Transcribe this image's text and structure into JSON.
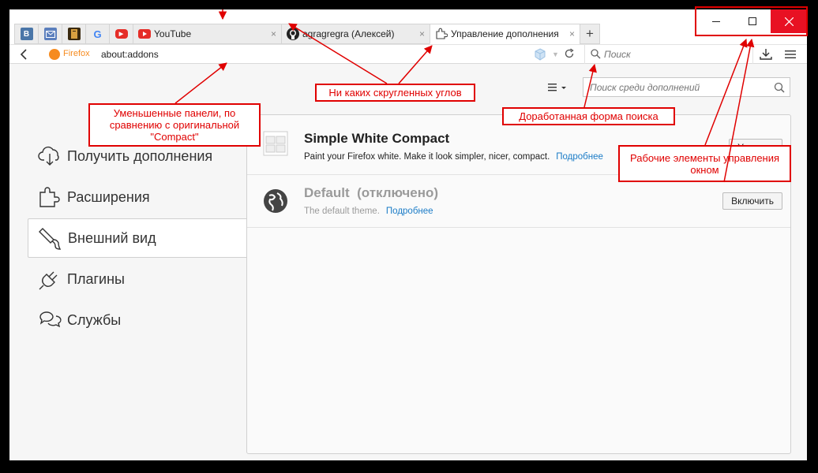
{
  "tabs": {
    "pinned": [
      {
        "name": "vk-icon",
        "label": "В",
        "color": "#4a76a8"
      },
      {
        "name": "mail-icon",
        "label": "",
        "color": "#5b7fbd"
      },
      {
        "name": "book-icon",
        "label": "",
        "color": "#3a2a10"
      },
      {
        "name": "google-icon",
        "label": "G",
        "color": "#ffffff"
      },
      {
        "name": "youtube-icon",
        "label": "▶",
        "color": "#e52d27"
      }
    ],
    "items": [
      {
        "label": "YouTube",
        "icon": "youtube-icon",
        "close": "×"
      },
      {
        "label": "agragregra (Алексей)",
        "icon": "github-icon",
        "close": "×"
      },
      {
        "label": "Управление дополнения",
        "icon": "puzzle-icon",
        "close": "×"
      }
    ],
    "new_tab": "+"
  },
  "window_controls": {
    "minimize": "—",
    "maximize": "☐",
    "close": "✕"
  },
  "navbar": {
    "identity": "Firefox",
    "url": "about:addons",
    "search_placeholder": "Поиск"
  },
  "sidebar": {
    "items": [
      {
        "label": "Получить дополнения",
        "icon": "cloud-download-icon"
      },
      {
        "label": "Расширения",
        "icon": "puzzle-icon"
      },
      {
        "label": "Внешний вид",
        "icon": "paintbrush-icon"
      },
      {
        "label": "Плагины",
        "icon": "plug-icon"
      },
      {
        "label": "Службы",
        "icon": "chat-bubbles-icon"
      }
    ],
    "selected_index": 2
  },
  "addons_search_placeholder": "Поиск среди дополнений",
  "themes": [
    {
      "name": "Simple White Compact",
      "state": "",
      "description": "Paint your Firefox white. Make it look simpler, nicer, compact.",
      "more": "Подробнее",
      "action": "Удалить"
    },
    {
      "name": "Default",
      "state": "(отключено)",
      "description": "The default theme.",
      "more": "Подробнее",
      "action": "Включить"
    }
  ],
  "annotations": {
    "compact": "Уменьшенные панели, по сравнению с оригинальной \"Compact\"",
    "corners": "Ни каких скругленных углов",
    "search": "Доработанная форма поиска",
    "window": "Рабочие элементы управления окном"
  },
  "colors": {
    "annotation": "#e00000",
    "link": "#1b7cc7",
    "close_red": "#e81123",
    "firefox_orange": "#f68b1f"
  }
}
